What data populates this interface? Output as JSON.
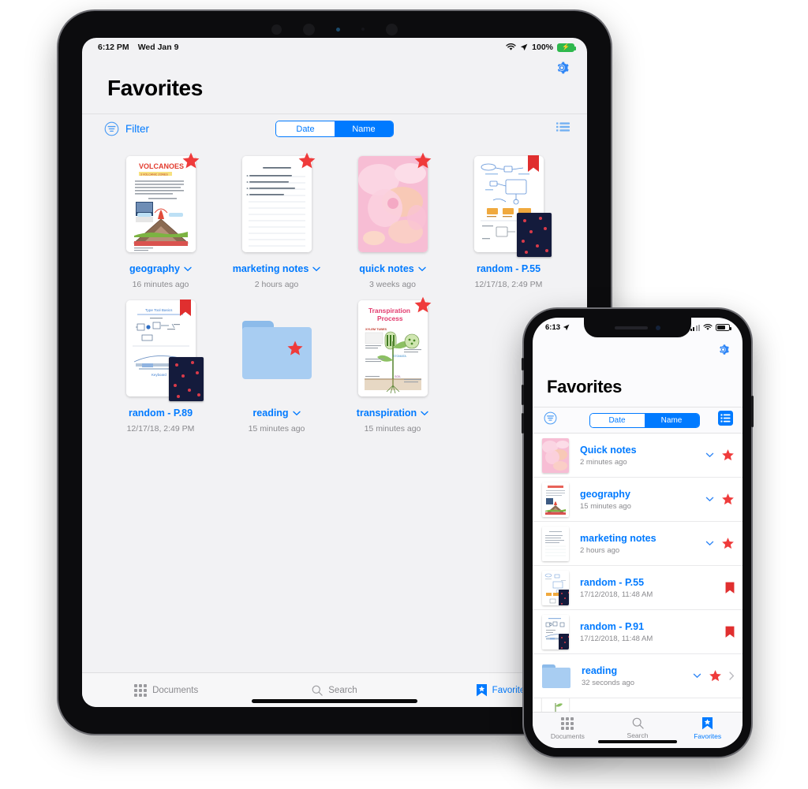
{
  "ipad": {
    "status": {
      "time": "6:12 PM",
      "date": "Wed Jan 9",
      "battery_pct": "100%",
      "wifi_icon": "wifi-icon",
      "location_icon": "location-arrow-icon",
      "battery_icon": "battery-charging-icon"
    },
    "nav": {
      "settings_icon": "gear-icon",
      "title": "Favorites"
    },
    "filter_bar": {
      "filter_icon": "filter-icon",
      "filter_label": "Filter",
      "segments": [
        {
          "label": "Date",
          "selected": false
        },
        {
          "label": "Name",
          "selected": true
        }
      ],
      "list_view_icon": "list-view-icon"
    },
    "items": [
      {
        "name": "geography",
        "date": "16 minutes ago",
        "badge": "star",
        "chevron": true,
        "thumb": "volcanoes-worksheet"
      },
      {
        "name": "marketing notes",
        "date": "2 hours ago",
        "badge": "star",
        "chevron": true,
        "thumb": "handwritten-lined-note"
      },
      {
        "name": "quick notes",
        "date": "3 weeks ago",
        "badge": "star",
        "chevron": true,
        "thumb": "pink-abstract-cover"
      },
      {
        "name": "random - P.55",
        "date": "12/17/18, 2:49 PM",
        "badge": "bookmark",
        "chevron": false,
        "thumb": "diagram-sketch-page"
      },
      {
        "name": "random - P.89",
        "date": "12/17/18, 2:49 PM",
        "badge": "bookmark",
        "chevron": false,
        "thumb": "diagram-sketch-page"
      },
      {
        "name": "reading",
        "date": "15 minutes ago",
        "badge": "star",
        "chevron": true,
        "thumb": "folder"
      },
      {
        "name": "transpiration",
        "date": "15 minutes ago",
        "badge": "star",
        "chevron": true,
        "thumb": "transpiration-process-diagram"
      }
    ],
    "tabs": [
      {
        "label": "Documents",
        "icon": "grid-icon",
        "active": false
      },
      {
        "label": "Search",
        "icon": "search-icon",
        "active": false
      },
      {
        "label": "Favorites",
        "icon": "bookmark-star-icon",
        "active": true
      }
    ]
  },
  "iphone": {
    "status": {
      "time": "6:13",
      "location_icon": "location-arrow-icon",
      "signal_icon": "cellular-bars-icon",
      "wifi_icon": "wifi-icon",
      "battery_icon": "battery-icon"
    },
    "nav": {
      "settings_icon": "gear-icon",
      "title": "Favorites"
    },
    "filter_bar": {
      "filter_icon": "filter-icon",
      "segments": [
        {
          "label": "Date",
          "selected": false
        },
        {
          "label": "Name",
          "selected": true
        }
      ],
      "list_view_icon": "list-view-icon"
    },
    "rows": [
      {
        "name": "Quick notes",
        "date": "2 minutes ago",
        "badge": "star",
        "chevron": true,
        "disclosure": false,
        "thumb": "pink-abstract-cover"
      },
      {
        "name": "geography",
        "date": "15 minutes ago",
        "badge": "star",
        "chevron": true,
        "disclosure": false,
        "thumb": "volcanoes-worksheet"
      },
      {
        "name": "marketing notes",
        "date": "2 hours ago",
        "badge": "star",
        "chevron": true,
        "disclosure": false,
        "thumb": "handwritten-lined-note"
      },
      {
        "name": "random - P.55",
        "date": "17/12/2018, 11:48 AM",
        "badge": "bookmark",
        "chevron": false,
        "disclosure": false,
        "thumb": "diagram-sketch-page"
      },
      {
        "name": "random - P.91",
        "date": "17/12/2018, 11:48 AM",
        "badge": "bookmark",
        "chevron": false,
        "disclosure": false,
        "thumb": "diagram-sketch-page"
      },
      {
        "name": "reading",
        "date": "32 seconds ago",
        "badge": "star",
        "chevron": true,
        "disclosure": true,
        "thumb": "folder"
      }
    ],
    "tabs": [
      {
        "label": "Documents",
        "icon": "grid-icon",
        "active": false
      },
      {
        "label": "Search",
        "icon": "search-icon",
        "active": false
      },
      {
        "label": "Favorites",
        "icon": "bookmark-star-icon",
        "active": true
      }
    ]
  },
  "colors": {
    "accent": "#007aff",
    "star": "#ef3b3b",
    "bookmark": "#e53935",
    "folder": "#a8cdf2",
    "muted": "#8a8a8e"
  }
}
